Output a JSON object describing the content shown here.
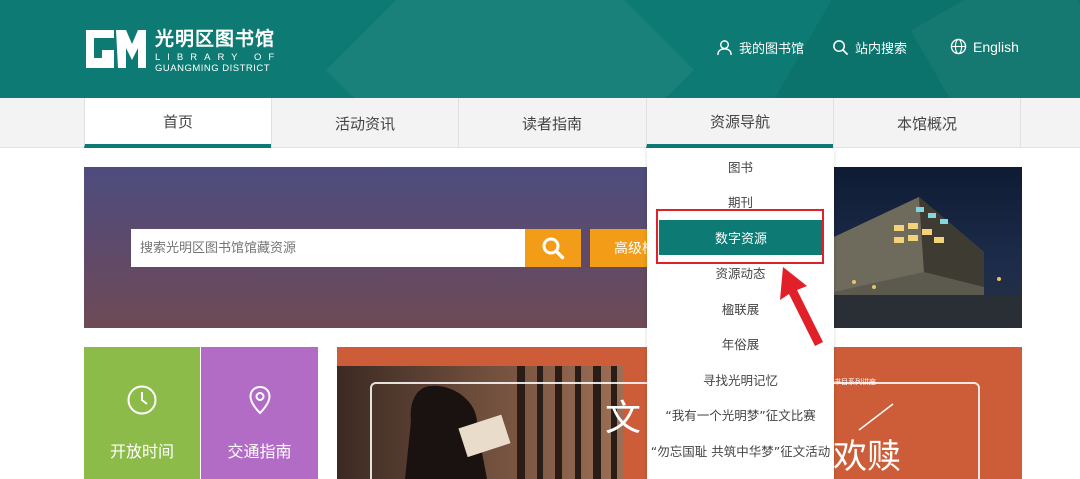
{
  "header": {
    "logo_cn": "光明区图书馆",
    "logo_en_line1": "LIBRARY OF",
    "logo_en_line2": "GUANGMING DISTRICT",
    "links": {
      "my_library": "我的图书馆",
      "site_search": "站内搜索",
      "english": "English"
    }
  },
  "nav": {
    "items": [
      {
        "label": "首页"
      },
      {
        "label": "活动资讯"
      },
      {
        "label": "读者指南"
      },
      {
        "label": "资源导航"
      },
      {
        "label": "本馆概况"
      }
    ],
    "active_index": 0
  },
  "dropdown": {
    "items": [
      {
        "label": "图书"
      },
      {
        "label": "期刊"
      },
      {
        "label": "数字资源"
      },
      {
        "label": "资源动态"
      },
      {
        "label": "楹联展"
      },
      {
        "label": "年俗展"
      },
      {
        "label": "寻找光明记忆"
      },
      {
        "label": "“我有一个光明梦”征文比赛"
      },
      {
        "label": "“勿忘国耻 共筑中华梦”征文活动"
      }
    ],
    "highlighted_index": 2
  },
  "search": {
    "placeholder": "搜索光明区图书馆馆藏资源",
    "advanced_label": "高级检索"
  },
  "tiles": {
    "open_hours": "开放时间",
    "traffic": "交通指南"
  },
  "event": {
    "char_left": "文",
    "char_right": "欢赎",
    "series_text": "书目系列讲座"
  },
  "colors": {
    "brand_teal": "#0d7b73",
    "accent_orange": "#f39c18",
    "tile_green": "#8cbb4a",
    "tile_purple": "#b36cc6",
    "highlight_red": "#e2202a"
  }
}
